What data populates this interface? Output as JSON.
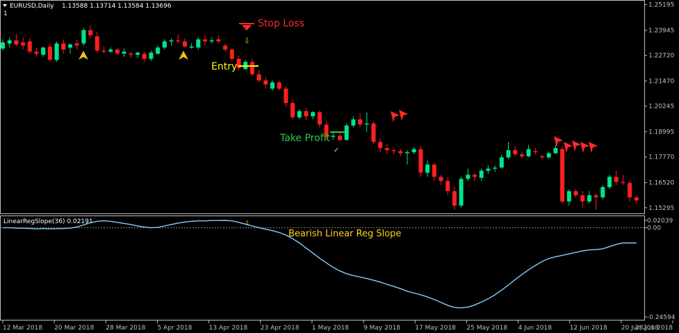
{
  "window": {
    "symbol_label": "EURUSD,Daily",
    "ohlc_label": "1.13588 1.13714 1.13584 1.13696",
    "sub_label": "1"
  },
  "colors": {
    "background": "#000000",
    "bull": "#00e58a",
    "bear": "#ff1f1f",
    "axis": "#c0c0c0",
    "indicator": "#87cefa",
    "annotation_red": "#ff2a2a",
    "annotation_yellow": "#ffff00",
    "annotation_green": "#2ecc40",
    "annotation_gold": "#ffd21f",
    "arrow_gold": "#f1c40f"
  },
  "annotations": {
    "stop_loss": "Stop Loss",
    "entry": "Entry",
    "take_profit": "Take Profit",
    "bearish_slope": "Bearish Linear Reg Slope"
  },
  "chart_data": [
    {
      "type": "candlestick",
      "title": "EURUSD,Daily",
      "y_ticks": [
        "1.25195",
        "1.23945",
        "1.22720",
        "1.21470",
        "1.20245",
        "1.18995",
        "1.17770",
        "1.16520",
        "1.15295"
      ],
      "y_tick_values": [
        1.25195,
        1.23945,
        1.2272,
        1.2147,
        1.20245,
        1.18995,
        1.1777,
        1.1652,
        1.15295
      ],
      "ylim": [
        1.1505,
        1.2535
      ],
      "x_ticks": [
        "12 Mar 2018",
        "20 Mar 2018",
        "28 Mar 2018",
        "5 Apr 2018",
        "13 Apr 2018",
        "23 Apr 2018",
        "1 May 2018",
        "9 May 2018",
        "17 May 2018",
        "25 May 2018",
        "4 Jun 2018",
        "12 Jun 2018",
        "20 Jun 2018",
        "28 Jun 2018"
      ],
      "candles": [
        [
          1.2305,
          1.235,
          1.2295,
          1.2335
        ],
        [
          1.233,
          1.236,
          1.231,
          1.2345
        ],
        [
          1.2345,
          1.2375,
          1.2315,
          1.2325
        ],
        [
          1.2335,
          1.236,
          1.23,
          1.232
        ],
        [
          1.234,
          1.2355,
          1.228,
          1.229
        ],
        [
          1.229,
          1.231,
          1.2265,
          1.228
        ],
        [
          1.2275,
          1.2315,
          1.2265,
          1.231
        ],
        [
          1.2315,
          1.233,
          1.224,
          1.225
        ],
        [
          1.225,
          1.234,
          1.224,
          1.233
        ],
        [
          1.233,
          1.235,
          1.228,
          1.23
        ],
        [
          1.231,
          1.233,
          1.228,
          1.2325
        ],
        [
          1.233,
          1.235,
          1.23,
          1.232
        ],
        [
          1.233,
          1.2405,
          1.232,
          1.2395
        ],
        [
          1.2395,
          1.242,
          1.2355,
          1.237
        ],
        [
          1.2365,
          1.2385,
          1.2285,
          1.2295
        ],
        [
          1.2295,
          1.2315,
          1.228,
          1.229
        ],
        [
          1.229,
          1.231,
          1.2285,
          1.23
        ],
        [
          1.23,
          1.231,
          1.2275,
          1.228
        ],
        [
          1.228,
          1.2305,
          1.2265,
          1.229
        ],
        [
          1.228,
          1.229,
          1.226,
          1.2275
        ],
        [
          1.2275,
          1.229,
          1.226,
          1.2285
        ],
        [
          1.228,
          1.229,
          1.224,
          1.2255
        ],
        [
          1.2255,
          1.2295,
          1.2245,
          1.2285
        ],
        [
          1.228,
          1.232,
          1.2275,
          1.231
        ],
        [
          1.231,
          1.235,
          1.23,
          1.234
        ],
        [
          1.234,
          1.2355,
          1.232,
          1.2345
        ],
        [
          1.2345,
          1.2375,
          1.233,
          1.234
        ],
        [
          1.234,
          1.2355,
          1.231,
          1.2315
        ],
        [
          1.231,
          1.233,
          1.2305,
          1.2315
        ],
        [
          1.231,
          1.236,
          1.23,
          1.235
        ],
        [
          1.235,
          1.237,
          1.232,
          1.234
        ],
        [
          1.234,
          1.236,
          1.233,
          1.2345
        ],
        [
          1.235,
          1.237,
          1.233,
          1.234
        ],
        [
          1.232,
          1.233,
          1.229,
          1.23
        ],
        [
          1.23,
          1.231,
          1.224,
          1.2255
        ],
        [
          1.2255,
          1.227,
          1.22,
          1.221
        ],
        [
          1.2205,
          1.225,
          1.22,
          1.224
        ],
        [
          1.224,
          1.2255,
          1.217,
          1.218
        ],
        [
          1.218,
          1.22,
          1.214,
          1.215
        ],
        [
          1.215,
          1.2165,
          1.211,
          1.213
        ],
        [
          1.211,
          1.215,
          1.21,
          1.214
        ],
        [
          1.214,
          1.215,
          1.21,
          1.211
        ],
        [
          1.211,
          1.212,
          1.202,
          1.204
        ],
        [
          1.204,
          1.2055,
          1.196,
          1.197
        ],
        [
          1.197,
          1.201,
          1.196,
          1.2
        ],
        [
          1.2,
          1.2015,
          1.1955,
          1.1975
        ],
        [
          1.1975,
          1.2,
          1.196,
          1.1995
        ],
        [
          1.1995,
          1.2005,
          1.192,
          1.1935
        ],
        [
          1.1935,
          1.195,
          1.186,
          1.1875
        ],
        [
          1.1875,
          1.19,
          1.186,
          1.188
        ],
        [
          1.188,
          1.19,
          1.185,
          1.186
        ],
        [
          1.186,
          1.194,
          1.1855,
          1.193
        ],
        [
          1.193,
          1.1975,
          1.192,
          1.196
        ],
        [
          1.196,
          1.199,
          1.192,
          1.1935
        ],
        [
          1.1935,
          1.1995,
          1.19,
          1.194
        ],
        [
          1.194,
          1.195,
          1.184,
          1.185
        ],
        [
          1.185,
          1.187,
          1.18,
          1.182
        ],
        [
          1.182,
          1.184,
          1.179,
          1.181
        ],
        [
          1.181,
          1.182,
          1.179,
          1.1805
        ],
        [
          1.1805,
          1.1815,
          1.178,
          1.1795
        ],
        [
          1.1795,
          1.181,
          1.174,
          1.18
        ],
        [
          1.18,
          1.1825,
          1.179,
          1.1815
        ],
        [
          1.1815,
          1.183,
          1.168,
          1.17
        ],
        [
          1.17,
          1.176,
          1.168,
          1.174
        ],
        [
          1.174,
          1.175,
          1.166,
          1.168
        ],
        [
          1.168,
          1.169,
          1.164,
          1.166
        ],
        [
          1.166,
          1.168,
          1.159,
          1.161
        ],
        [
          1.161,
          1.1635,
          1.152,
          1.154
        ],
        [
          1.154,
          1.168,
          1.153,
          1.167
        ],
        [
          1.167,
          1.172,
          1.166,
          1.169
        ],
        [
          1.169,
          1.17,
          1.166,
          1.168
        ],
        [
          1.1675,
          1.172,
          1.166,
          1.171
        ],
        [
          1.171,
          1.1735,
          1.1695,
          1.172
        ],
        [
          1.172,
          1.1735,
          1.1705,
          1.1725
        ],
        [
          1.1725,
          1.179,
          1.172,
          1.1775
        ],
        [
          1.1775,
          1.185,
          1.1765,
          1.181
        ],
        [
          1.181,
          1.183,
          1.178,
          1.179
        ],
        [
          1.179,
          1.1805,
          1.177,
          1.178
        ],
        [
          1.178,
          1.1835,
          1.1775,
          1.1815
        ],
        [
          1.1805,
          1.182,
          1.179,
          1.18
        ],
        [
          1.178,
          1.179,
          1.1765,
          1.1775
        ],
        [
          1.1775,
          1.18,
          1.1765,
          1.1795
        ],
        [
          1.1795,
          1.1835,
          1.179,
          1.182
        ],
        [
          1.1815,
          1.183,
          1.155,
          1.156
        ],
        [
          1.156,
          1.162,
          1.154,
          1.161
        ],
        [
          1.161,
          1.162,
          1.158,
          1.159
        ],
        [
          1.159,
          1.161,
          1.153,
          1.156
        ],
        [
          1.156,
          1.161,
          1.155,
          1.159
        ],
        [
          1.159,
          1.16,
          1.152,
          1.158
        ],
        [
          1.158,
          1.164,
          1.157,
          1.163
        ],
        [
          1.163,
          1.169,
          1.162,
          1.168
        ],
        [
          1.168,
          1.171,
          1.164,
          1.1655
        ],
        [
          1.1655,
          1.169,
          1.164,
          1.165
        ],
        [
          1.165,
          1.166,
          1.156,
          1.158
        ],
        [
          1.158,
          1.159,
          1.155,
          1.1565
        ]
      ],
      "annotations": [
        "Stop Loss",
        "Entry",
        "Take Profit"
      ]
    },
    {
      "type": "line",
      "title": "LinearRegSlope(36) 0.02191",
      "series": [
        {
          "name": "LinearRegSlope(36)",
          "values": [
            0.0,
            0.0,
            -0.001,
            -0.001,
            -0.002,
            -0.003,
            -0.002,
            -0.003,
            -0.0025,
            -0.002,
            -0.001,
            0.002,
            0.008,
            0.014,
            0.018,
            0.019,
            0.018,
            0.015,
            0.012,
            0.009,
            0.005,
            0.002,
            0.0,
            0.001,
            0.005,
            0.009,
            0.013,
            0.016,
            0.018,
            0.019,
            0.019,
            0.02,
            0.02,
            0.0205,
            0.019,
            0.015,
            0.01,
            0.005,
            0.0,
            -0.004,
            -0.008,
            -0.013,
            -0.02,
            -0.03,
            -0.042,
            -0.056,
            -0.07,
            -0.084,
            -0.097,
            -0.109,
            -0.119,
            -0.127,
            -0.132,
            -0.136,
            -0.14,
            -0.145,
            -0.15,
            -0.156,
            -0.162,
            -0.168,
            -0.175,
            -0.18,
            -0.185,
            -0.191,
            -0.198,
            -0.206,
            -0.214,
            -0.22,
            -0.221,
            -0.219,
            -0.213,
            -0.205,
            -0.196,
            -0.185,
            -0.172,
            -0.158,
            -0.143,
            -0.129,
            -0.116,
            -0.104,
            -0.093,
            -0.085,
            -0.08,
            -0.076,
            -0.072,
            -0.068,
            -0.064,
            -0.061,
            -0.06,
            -0.058,
            -0.052,
            -0.046,
            -0.042,
            -0.042,
            -0.042
          ]
        }
      ],
      "y_ticks": [
        "0.02039",
        "0.00",
        "-0.24594"
      ],
      "y_tick_values": [
        0.02039,
        0.0,
        -0.24594
      ],
      "ylim": [
        -0.252,
        0.03
      ],
      "reference_level": 0.0,
      "annotations": [
        "Bearish Linear Reg Slope"
      ]
    }
  ]
}
